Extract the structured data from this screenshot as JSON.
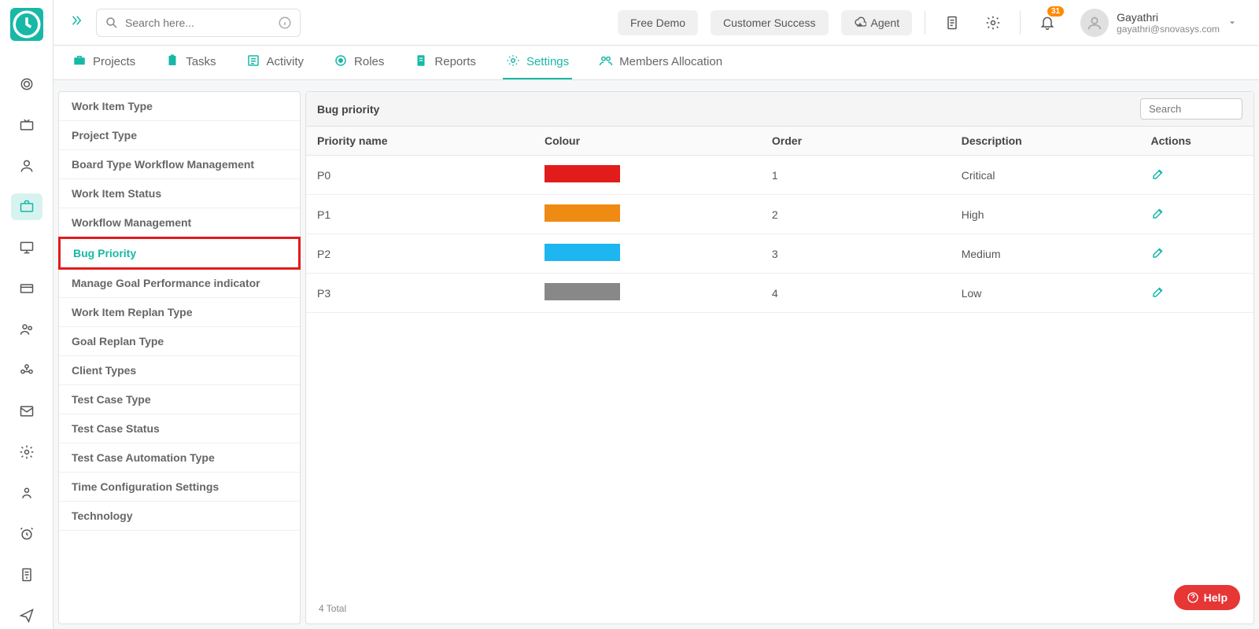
{
  "header": {
    "search_placeholder": "Search here...",
    "buttons": {
      "free_demo": "Free Demo",
      "customer_success": "Customer Success",
      "agent": "Agent"
    },
    "notification_count": "31",
    "user": {
      "name": "Gayathri",
      "email": "gayathri@snovasys.com"
    }
  },
  "nav": {
    "projects": "Projects",
    "tasks": "Tasks",
    "activity": "Activity",
    "roles": "Roles",
    "reports": "Reports",
    "settings": "Settings",
    "members_allocation": "Members Allocation"
  },
  "settings_menu": [
    "Work Item Type",
    "Project Type",
    "Board Type Workflow Management",
    "Work Item Status",
    "Workflow Management",
    "Bug Priority",
    "Manage Goal Performance indicator",
    "Work Item Replan Type",
    "Goal Replan Type",
    "Client Types",
    "Test Case Type",
    "Test Case Status",
    "Test Case Automation Type",
    "Time Configuration Settings",
    "Technology"
  ],
  "panel": {
    "title": "Bug priority",
    "search_placeholder": "Search",
    "columns": {
      "name": "Priority name",
      "colour": "Colour",
      "order": "Order",
      "description": "Description",
      "actions": "Actions"
    },
    "rows": [
      {
        "name": "P0",
        "color": "#e21b1b",
        "order": "1",
        "description": "Critical"
      },
      {
        "name": "P1",
        "color": "#ef8b13",
        "order": "2",
        "description": "High"
      },
      {
        "name": "P2",
        "color": "#1db6f0",
        "order": "3",
        "description": "Medium"
      },
      {
        "name": "P3",
        "color": "#888888",
        "order": "4",
        "description": "Low"
      }
    ],
    "footer": "4 Total"
  },
  "help_label": "Help"
}
